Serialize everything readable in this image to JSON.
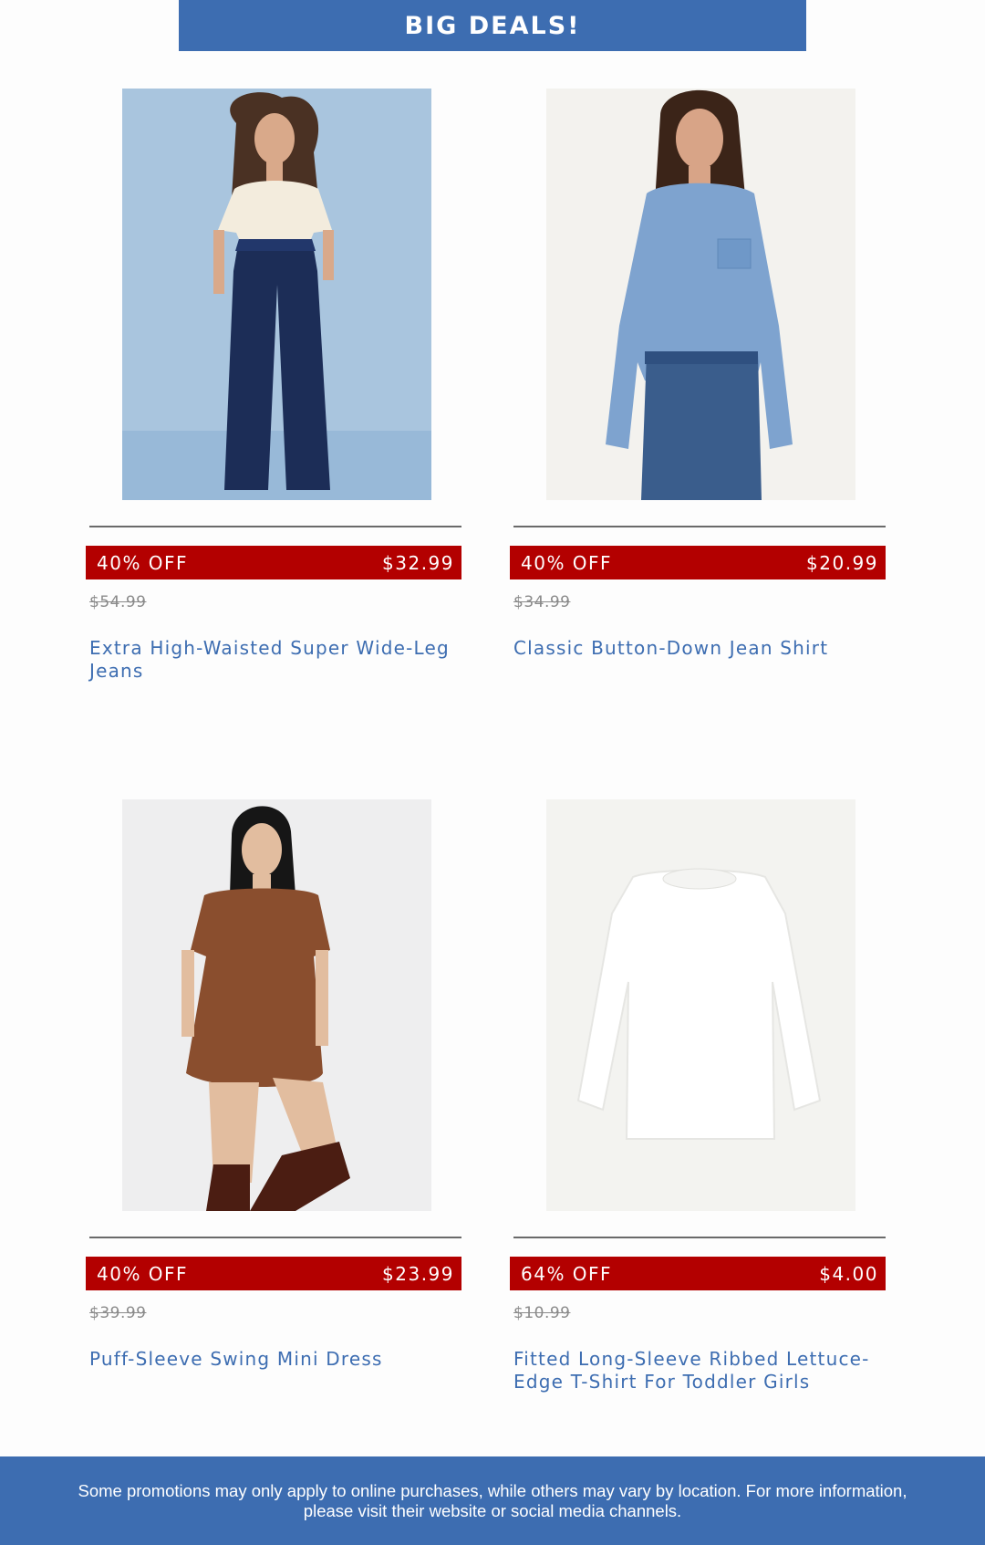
{
  "banner": {
    "title": "BIG DEALS!"
  },
  "products": [
    {
      "discount": "40% OFF",
      "price": "$32.99",
      "original_price": "$54.99",
      "name": "Extra High-Waisted Super Wide-Leg Jeans"
    },
    {
      "discount": "40% OFF",
      "price": "$20.99",
      "original_price": "$34.99",
      "name": "Classic Button-Down Jean Shirt"
    },
    {
      "discount": "40% OFF",
      "price": "$23.99",
      "original_price": "$39.99",
      "name": "Puff-Sleeve Swing Mini Dress"
    },
    {
      "discount": "64% OFF",
      "price": "$4.00",
      "original_price": "$10.99",
      "name": "Fitted Long-Sleeve Ribbed Lettuce-Edge T-Shirt For Toddler Girls"
    }
  ],
  "footer": {
    "text": "Some promotions may only apply to online purchases, while others may vary by location. For more information, please visit their website or social media channels."
  },
  "colors": {
    "brand_blue": "#3d6db1",
    "deal_red": "#b30000",
    "strike_gray": "#8a8a8a"
  }
}
